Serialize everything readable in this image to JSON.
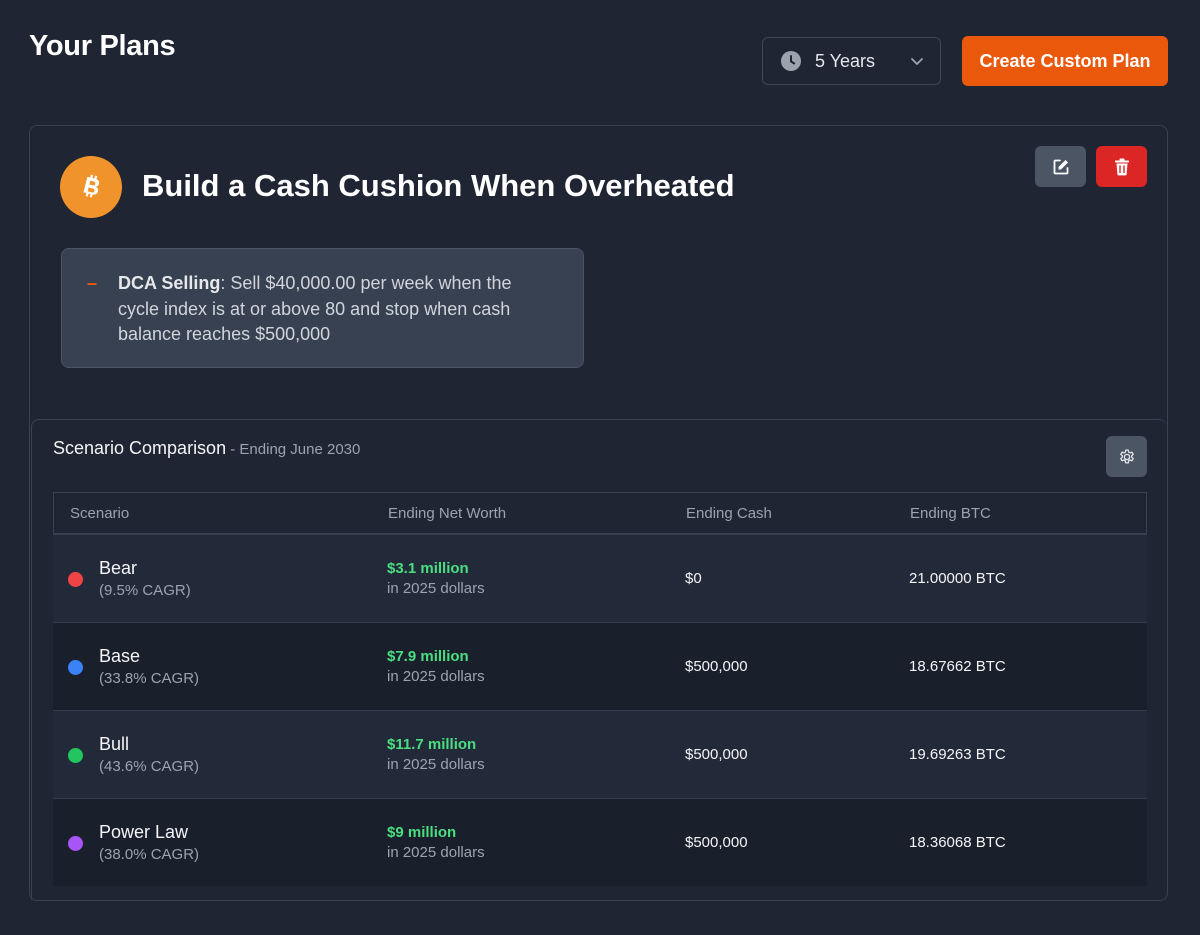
{
  "page": {
    "title": "Your Plans"
  },
  "toolbar": {
    "period_icon": "clock-icon",
    "period_value": "5 Years",
    "create_label": "Create Custom Plan"
  },
  "plan": {
    "icon": "bitcoin-icon",
    "title": "Build a Cash Cushion When Overheated",
    "strategy": {
      "label": "DCA Selling",
      "text": ": Sell $40,000.00 per week when the cycle index is at or above 80 and stop when cash balance reaches $500,000"
    }
  },
  "scenarios": {
    "heading": "Scenario Comparison",
    "subheading": " - Ending June 2030",
    "columns": [
      "Scenario",
      "Ending Net Worth",
      "Ending Cash",
      "Ending BTC"
    ],
    "rows": [
      {
        "name": "Bear",
        "cagr": "(9.5% CAGR)",
        "color": "#ef4444",
        "net_worth": "$3.1 million",
        "net_worth_note": "in 2025 dollars",
        "cash": "$0",
        "btc": "21.00000 BTC"
      },
      {
        "name": "Base",
        "cagr": "(33.8% CAGR)",
        "color": "#3b82f6",
        "net_worth": "$7.9 million",
        "net_worth_note": "in 2025 dollars",
        "cash": "$500,000",
        "btc": "18.67662 BTC"
      },
      {
        "name": "Bull",
        "cagr": "(43.6% CAGR)",
        "color": "#22c55e",
        "net_worth": "$11.7 million",
        "net_worth_note": "in 2025 dollars",
        "cash": "$500,000",
        "btc": "19.69263 BTC"
      },
      {
        "name": "Power Law",
        "cagr": "(38.0% CAGR)",
        "color": "#a855f7",
        "net_worth": "$9 million",
        "net_worth_note": "in 2025 dollars",
        "cash": "$500,000",
        "btc": "18.36068 BTC"
      }
    ]
  },
  "colors": {
    "background": "#1f2533",
    "accent": "#ea580c",
    "danger": "#dc2626",
    "positive": "#4ade80",
    "bitcoin": "#f0932b"
  }
}
